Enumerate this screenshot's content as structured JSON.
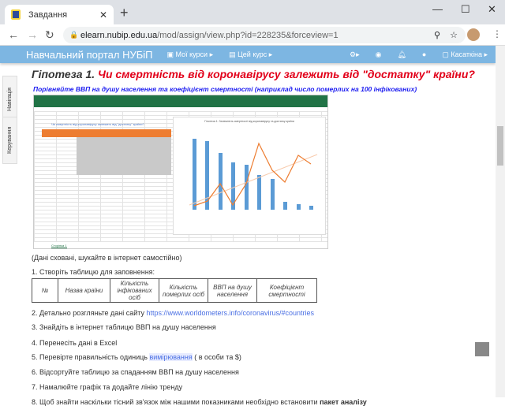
{
  "browser": {
    "tab_title": "Завдання",
    "url_host": "elearn.nubip.edu.ua",
    "url_path": "/mod/assign/view.php?id=228235&forceview=1"
  },
  "portal": {
    "brand": "Навчальний портал НУБіП",
    "my_courses": "Мої курси",
    "this_course": "Цей курс",
    "user": "Касаткіна"
  },
  "side_tabs": [
    "Навігація",
    "Керування"
  ],
  "page": {
    "heading_prefix": "Гіпотеза 1.",
    "heading": "Чи смертність від коронавірусу залежить від \"достатку\" країни?",
    "subtitle": "Порівняйте ВВП на душу населення та коефіцієнт смертності (наприклад  число померлих на 100 інфікованих)",
    "excel": {
      "sheet_tab": "Сторінка 1",
      "sheet_heading": "Чи смертність від коронавірусу залежить від \"достатку\" країни?",
      "chart_title": "Гіпотеза 1. Залежність смертності від коронавірусу та достатку країни"
    },
    "note": "(Дані сховані, шукайте в інтернет самостійно)",
    "step1": "1. Створіть таблицю для заповнення:",
    "table_headers": [
      "№",
      "Назва країни",
      "Кількість інфікованих осіб",
      "Кількість померлих осіб",
      "ВВП на душу населення",
      "Коефіцієнт смертності"
    ],
    "step2": "2. Детально розгляньте дані сайту ",
    "step2_link": "https://www.worldometers.info/coronavirus/#countries",
    "step3": "3. Знайдіть в інтернет таблицю ВВП на душу населення",
    "step4": "4. Перенесіть дані в Excel",
    "step5_a": "5. Перевірте правильність одиниць ",
    "step5_hl": "вимірювання",
    "step5_b": " ( в особи та $)",
    "step6": "6. Відсортуйте таблицю за спаданням  ВВП на душу населення",
    "step7": "7. Намалюйте графік та додайте лінію тренду",
    "step8": "8. Щоб знайти наскільки тісний зв'язок між нашими показниками необхідно встановити ",
    "step8_bold": "пакет аналізу"
  }
}
